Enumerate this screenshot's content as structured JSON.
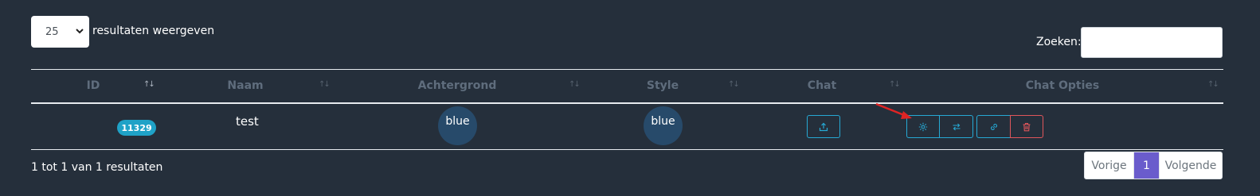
{
  "length_control": {
    "value": "25",
    "label": "resultaten weergeven"
  },
  "search": {
    "label": "Zoeken:",
    "value": ""
  },
  "table": {
    "columns": [
      "ID",
      "Naam",
      "Achtergrond",
      "Style",
      "Chat",
      "Chat Opties"
    ],
    "rows": [
      {
        "id": "11329",
        "naam": "test",
        "achtergrond": "blue",
        "style": "blue"
      }
    ]
  },
  "footer": {
    "info": "1 tot 1 van 1 resultaten",
    "pagination": {
      "prev": "Vorige",
      "current": "1",
      "next": "Volgende"
    }
  },
  "colors": {
    "background": "#252f3b",
    "badge": "#1fa2c7",
    "outline_button": "#26a9d4",
    "danger": "#e0565b",
    "page_active": "#6a5ccc",
    "circle": "#274a6a",
    "annotation_arrow": "#e02424"
  },
  "icons": {
    "chat": "upload-icon",
    "options": [
      "gear-icon",
      "swap-icon",
      "link-icon",
      "trash-icon"
    ]
  }
}
